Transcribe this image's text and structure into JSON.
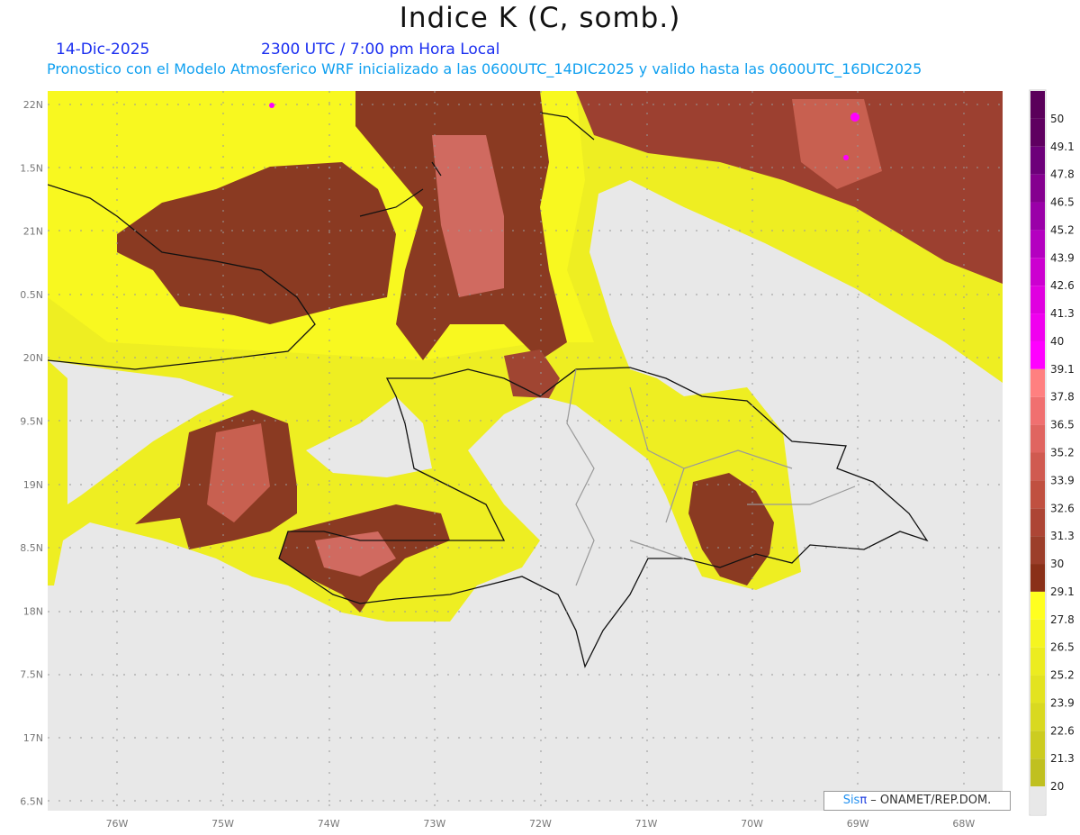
{
  "header": {
    "title": "Indice K (C, somb.)",
    "date": "14-Dic-2025",
    "time": "2300 UTC / 7:00 pm Hora Local",
    "subtitle": "Pronostico con el Modelo Atmosferico WRF inicializado a las 0600UTC_14DIC2025 y valido hasta las  0600UTC_16DIC2025"
  },
  "map": {
    "lat_labels": [
      "22N",
      "1.5N",
      "21N",
      "0.5N",
      "20N",
      "9.5N",
      "19N",
      "8.5N",
      "18N",
      "7.5N",
      "17N",
      "6.5N"
    ],
    "lon_labels": [
      "76W",
      "75W",
      "74W",
      "73W",
      "72W",
      "71W",
      "70W",
      "69W",
      "68W"
    ]
  },
  "colorbar": {
    "labels": [
      "50",
      "49.1",
      "47.8",
      "46.5",
      "45.2",
      "43.9",
      "42.6",
      "41.3",
      "40",
      "39.1",
      "37.8",
      "36.5",
      "35.2",
      "33.9",
      "32.6",
      "31.3",
      "30",
      "29.1",
      "27.8",
      "26.5",
      "25.2",
      "23.9",
      "22.6",
      "21.3",
      "20"
    ],
    "colors": [
      "#5f0060",
      "#6d007a",
      "#85008f",
      "#9a00a8",
      "#b400c0",
      "#cc00d0",
      "#e000e0",
      "#f000ef",
      "#ff00ff",
      "#ff8080",
      "#f07070",
      "#e06560",
      "#d05a50",
      "#c05040",
      "#ad4535",
      "#9c3e2a",
      "#8a3018",
      "#ffff20",
      "#f5f520",
      "#ecec20",
      "#e3e320",
      "#d9d920",
      "#cccc20",
      "#c0c020",
      "#e8e8e8"
    ]
  },
  "credit": {
    "sis": "Sis",
    "pi": "π",
    "rest": " – ONAMET/REP.DOM."
  }
}
